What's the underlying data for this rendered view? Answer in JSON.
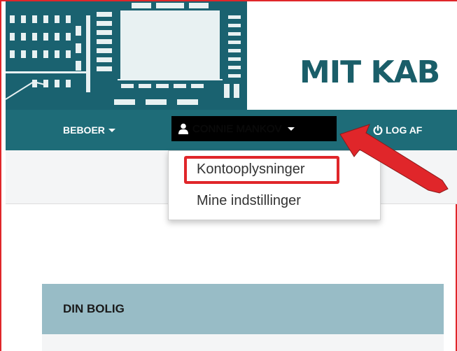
{
  "header": {
    "brand": "MIT KAB"
  },
  "nav": {
    "beboer_label": "BEBOER",
    "user_name": "CONNIE MANKOV",
    "logout_label": "LOG AF"
  },
  "dropdown": {
    "items": [
      {
        "label": "Kontooplysninger"
      },
      {
        "label": "Mine indstillinger"
      }
    ]
  },
  "card": {
    "title": "DIN BOLIG"
  },
  "colors": {
    "navbar": "#1e6c78",
    "logo_bg": "#1a6270",
    "brand": "#1a5e69",
    "highlight": "#e0262a",
    "card_header": "#98bcc6"
  }
}
